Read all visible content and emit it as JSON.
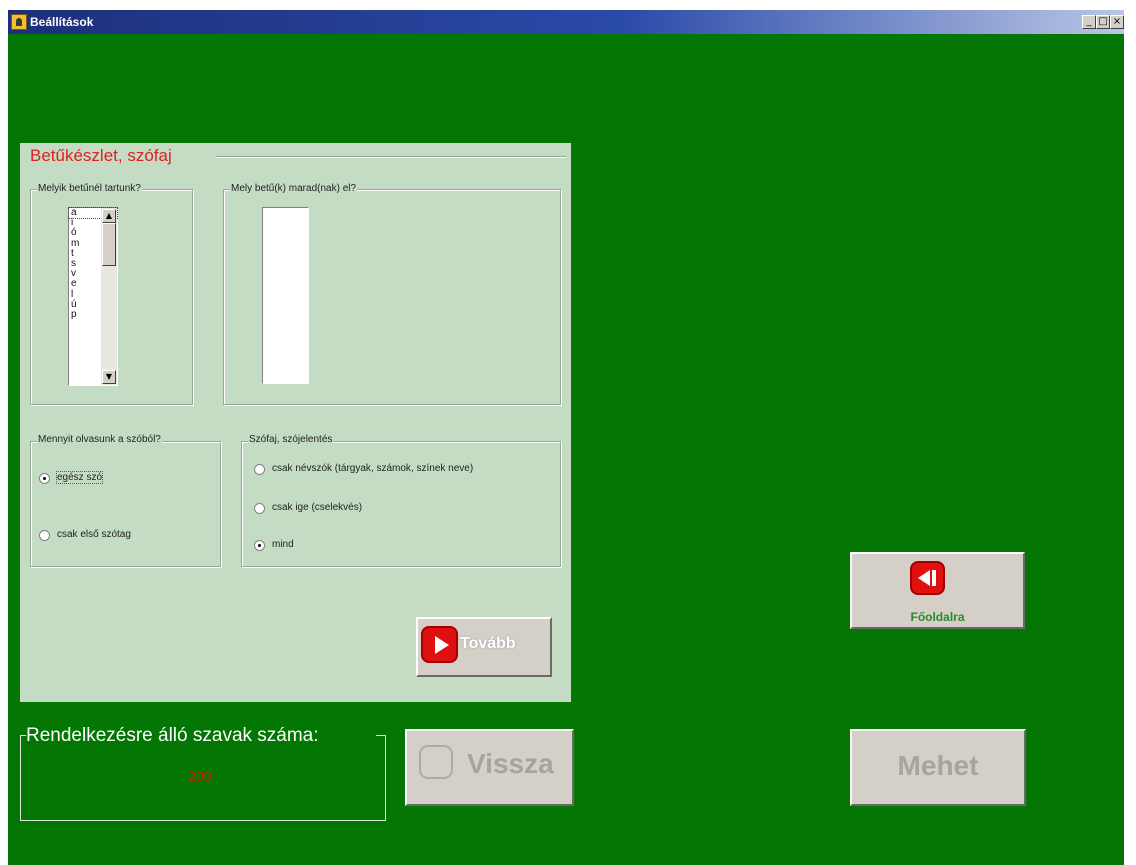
{
  "window": {
    "title": "Beállítások",
    "controls": {
      "minimize": "_",
      "maximize": "□",
      "close": "×"
    }
  },
  "panel": {
    "title": "Betűkészlet, szófaj",
    "letters_group": {
      "label": "Melyik betűnél tartunk?",
      "items": [
        "a",
        "i",
        "ó",
        "m",
        "t",
        "s",
        "v",
        "e",
        "l",
        "ú",
        "p"
      ],
      "selected_index": 0
    },
    "remaining_group": {
      "label": "Mely betű(k) marad(nak) el?"
    },
    "reading_group": {
      "label": "Mennyit olvasunk a szóból?",
      "options": [
        {
          "label": "egész szó",
          "checked": true
        },
        {
          "label": "csak első szótag",
          "checked": false
        }
      ]
    },
    "wordtype_group": {
      "label": "Szófaj, szójelentés",
      "options": [
        {
          "label": "csak névszók (tárgyak, számok, színek neve)",
          "checked": false
        },
        {
          "label": "csak ige (cselekvés)",
          "checked": false
        },
        {
          "label": "mind",
          "checked": true
        }
      ]
    },
    "next_button": {
      "label": "Tovább",
      "icon": "play-icon"
    }
  },
  "buttons": {
    "home": {
      "label": "Főoldalra",
      "icon": "back-to-start-icon"
    },
    "back": {
      "label": "Vissza",
      "enabled": false
    },
    "go": {
      "label": "Mehet",
      "enabled": false
    }
  },
  "words": {
    "label": "Rendelkezésre álló szavak száma:",
    "count": "200"
  },
  "colors": {
    "background": "#047604",
    "panel": "#c4dcc4",
    "panel_title": "#e02020",
    "accent_red": "#e01010",
    "count_text": "#cc2200"
  }
}
